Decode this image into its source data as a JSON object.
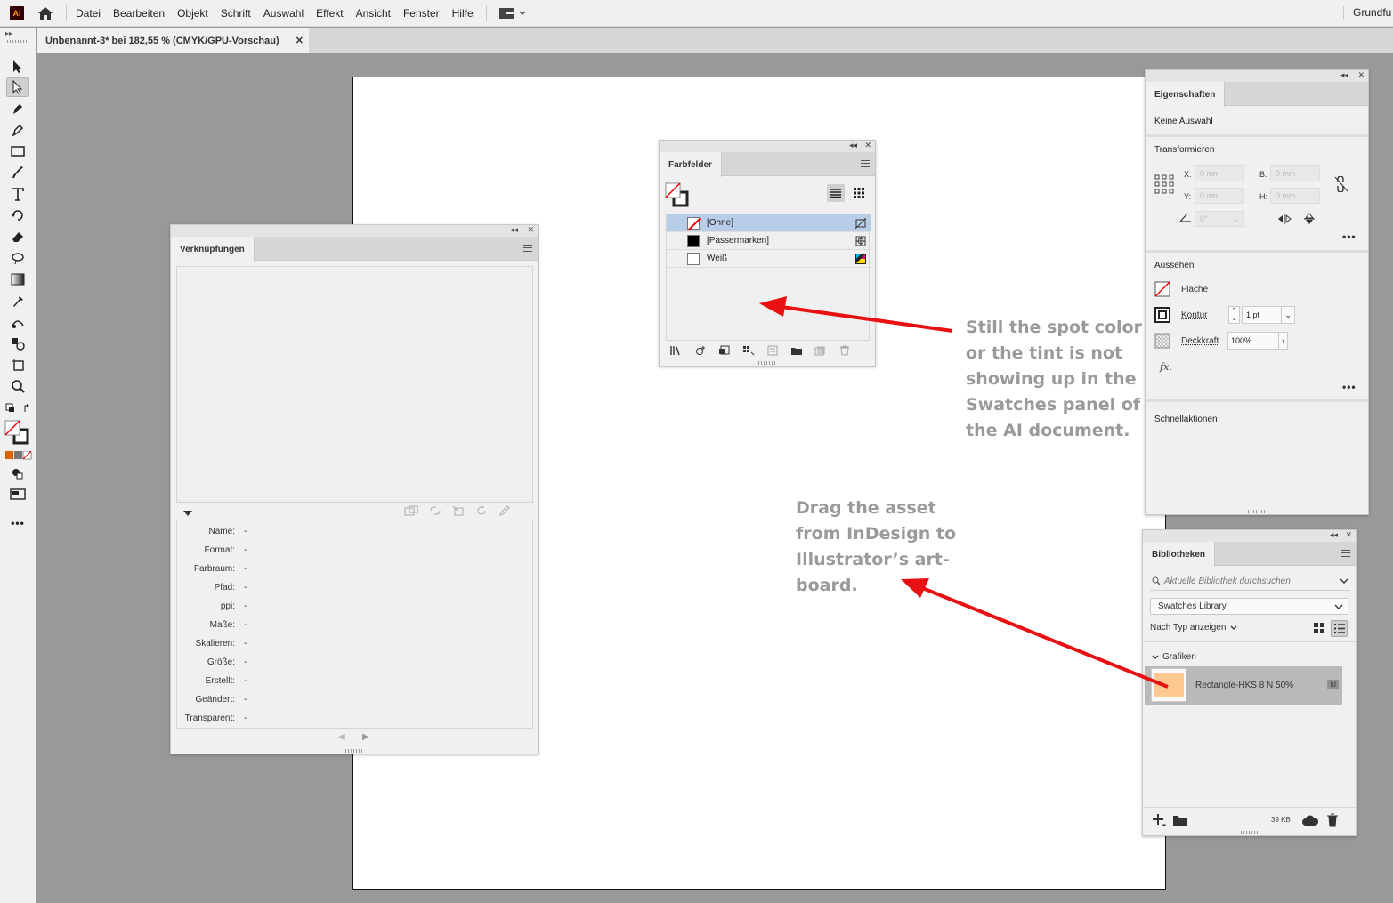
{
  "app": {
    "logo": "Ai",
    "menu": [
      "Datei",
      "Bearbeiten",
      "Objekt",
      "Schrift",
      "Auswahl",
      "Effekt",
      "Ansicht",
      "Fenster",
      "Hilfe"
    ],
    "workspace": "Grundfu"
  },
  "document_tab": {
    "title": "Unbenannt-3* bei 182,55 % (CMYK/GPU-Vorschau)",
    "close": "✕"
  },
  "farbfelder": {
    "tab": "Farbfelder",
    "swatches": [
      {
        "name": "[Ohne]",
        "color": "none",
        "selected": true
      },
      {
        "name": "[Passermarken]",
        "color": "#000000",
        "selected": false
      },
      {
        "name": "Weiß",
        "color": "#ffffff",
        "selected": false
      }
    ]
  },
  "verknuepfungen": {
    "tab": "Verknüpfungen",
    "info": [
      {
        "label": "Name:",
        "value": "-"
      },
      {
        "label": "Format:",
        "value": "-"
      },
      {
        "label": "Farbraum:",
        "value": "-"
      },
      {
        "label": "Pfad:",
        "value": "-"
      },
      {
        "label": "ppi:",
        "value": "-"
      },
      {
        "label": "Maße:",
        "value": "-"
      },
      {
        "label": "Skalieren:",
        "value": "-"
      },
      {
        "label": "Größe:",
        "value": "-"
      },
      {
        "label": "Erstellt:",
        "value": "-"
      },
      {
        "label": "Geändert:",
        "value": "-"
      },
      {
        "label": "Transparent:",
        "value": "-"
      }
    ]
  },
  "eigenschaften": {
    "tab": "Eigenschaften",
    "no_selection": "Keine Auswahl",
    "transform_title": "Transformieren",
    "x_label": "X:",
    "x_value": "0 mm",
    "y_label": "Y:",
    "y_value": "0 mm",
    "b_label": "B:",
    "b_value": "0 mm",
    "h_label": "H:",
    "h_value": "0 mm",
    "angle_value": "0°",
    "aussehen_title": "Aussehen",
    "flaeche": "Fläche",
    "kontur": "Kontur",
    "kontur_value": "1 pt",
    "deckkraft": "Deckkraft",
    "deckkraft_value": "100%",
    "fx": "fx.",
    "schnellaktionen": "Schnellaktionen"
  },
  "bibliotheken": {
    "tab": "Bibliotheken",
    "search_placeholder": "Aktuelle Bibliothek durchsuchen",
    "library": "Swatches Library",
    "filter": "Nach Typ anzeigen",
    "group": "Grafiken",
    "asset_name": "Rectangle-HKS 8 N 50%",
    "asset_badge": "Id",
    "asset_color": "#ffc990",
    "size": "39 KB"
  },
  "annotations": {
    "top": [
      "Still the spot color",
      "or the tint is not",
      "showing up in the",
      "Swatches panel of",
      "the AI document."
    ],
    "bottom": [
      "Drag the asset",
      "from InDesign to",
      "Illustrator’s art-",
      "board."
    ],
    "arrow_color": "#e81010"
  }
}
